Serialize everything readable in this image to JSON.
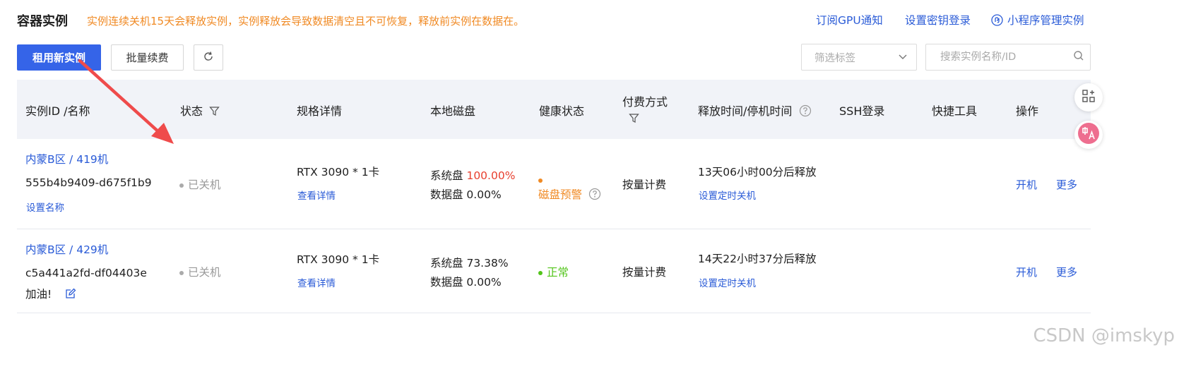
{
  "header": {
    "title": "容器实例",
    "notice": "实例连续关机15天会释放实例，实例释放会导致数据清空且不可恢复，释放前实例在数据在。",
    "links": {
      "subscribe": "订阅GPU通知",
      "key_login": "设置密钥登录",
      "mini_program": "小程序管理实例"
    }
  },
  "toolbar": {
    "rent_label": "租用新实例",
    "renew_label": "批量续费",
    "filter_placeholder": "筛选标签",
    "search_placeholder": "搜索实例名称/ID"
  },
  "table": {
    "columns": {
      "id_name": "实例ID /名称",
      "status": "状态",
      "spec": "规格详情",
      "disk": "本地磁盘",
      "health": "健康状态",
      "billing": "付费方式",
      "release": "释放时间/停机时间",
      "ssh": "SSH登录",
      "tools": "快捷工具",
      "ops": "操作"
    },
    "rows": [
      {
        "region": "内蒙B区 / 419机",
        "id": "555b4b9409-d675f1b9",
        "name_action": "设置名称",
        "status": "已关机",
        "spec": "RTX 3090 * 1卡",
        "spec_link": "查看详情",
        "sys_disk_label": "系统盘",
        "sys_disk_value": "100.00%",
        "data_disk": "数据盘 0.00%",
        "health": "磁盘预警",
        "billing": "按量计费",
        "release": "13天06小时00分后释放",
        "timer": "设置定时关机",
        "power": "开机",
        "more": "更多"
      },
      {
        "region": "内蒙B区 / 429机",
        "id": "c5a441a2fd-df04403e",
        "name": "加油!",
        "status": "已关机",
        "spec": "RTX 3090 * 1卡",
        "spec_link": "查看详情",
        "sys_disk_label": "系统盘",
        "sys_disk_value": "73.38%",
        "data_disk": "数据盘 0.00%",
        "health": "正常",
        "billing": "按量计费",
        "release": "14天22小时37分后释放",
        "timer": "设置定时关机",
        "power": "开机",
        "more": "更多"
      }
    ]
  },
  "colors": {
    "accent": "#3564e8",
    "link": "#2a5bd7",
    "warning": "#f08a24",
    "danger": "#e8402f",
    "success": "#52c41a",
    "annotation_arrow": "#ef4b4b"
  },
  "icons": [
    "refresh-icon",
    "chevron-down-icon",
    "search-icon",
    "filter-icon",
    "help-icon",
    "edit-icon",
    "mini-program-icon",
    "apps-icon",
    "translate-icon"
  ],
  "watermark": "CSDN @imskyp"
}
